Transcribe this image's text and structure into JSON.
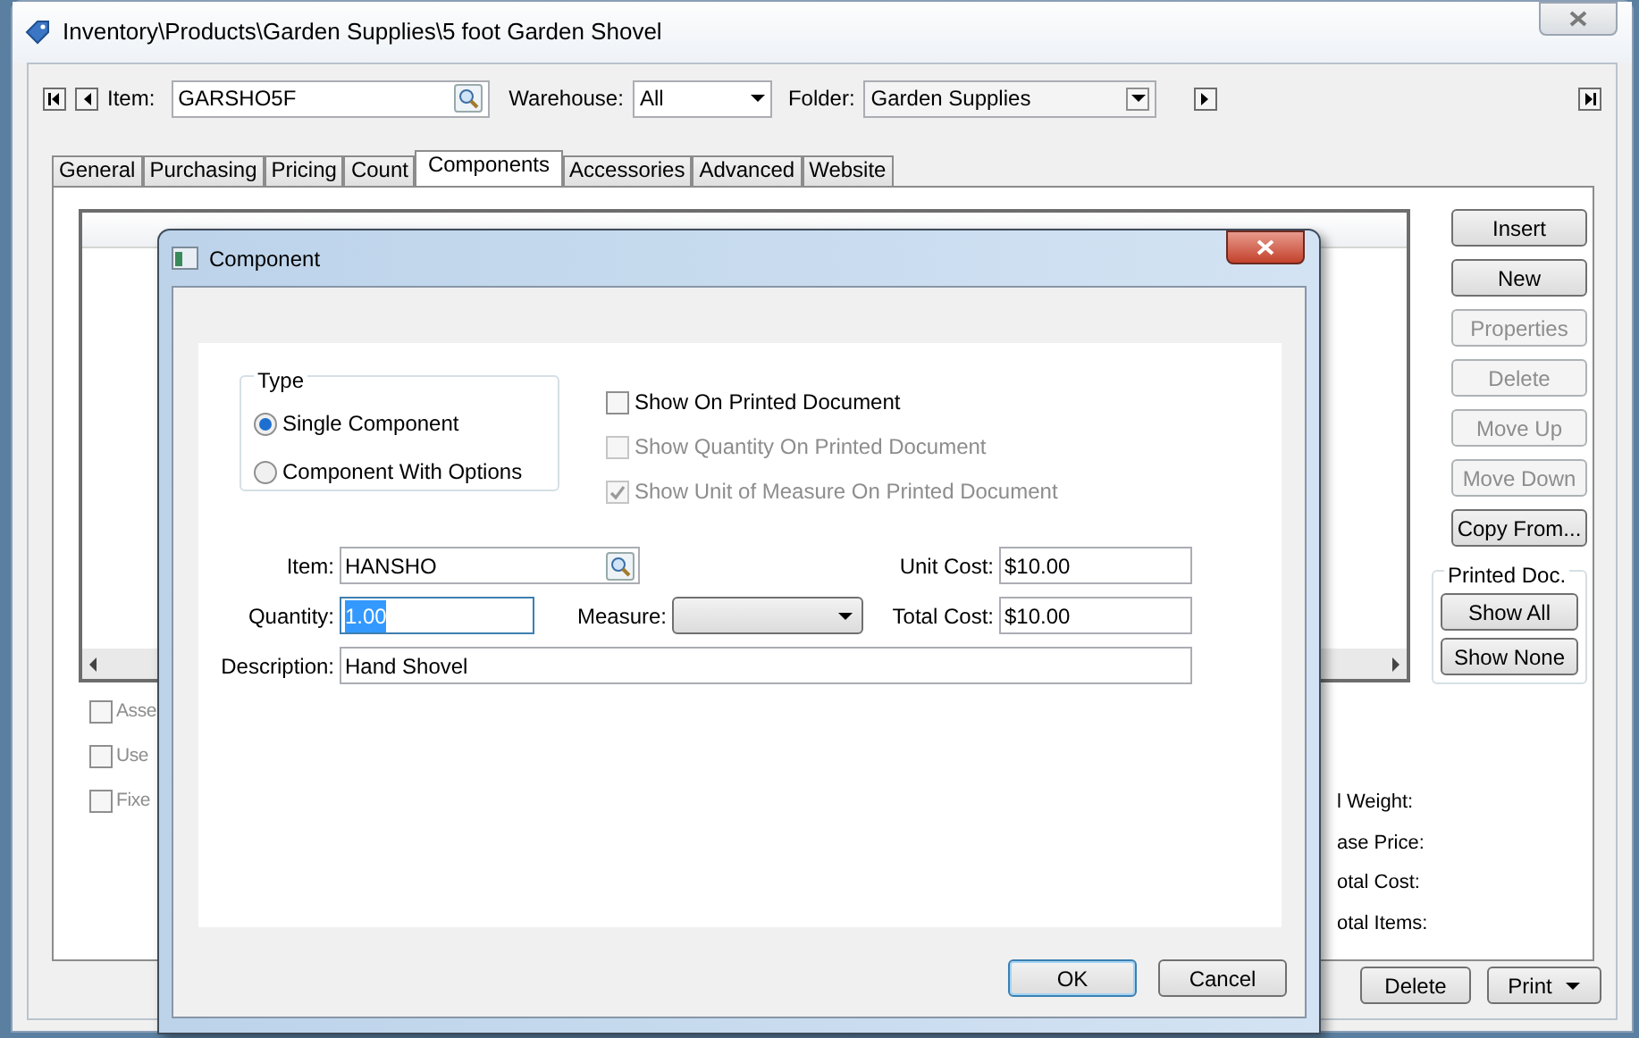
{
  "window": {
    "title": "Inventory\\Products\\Garden Supplies\\5 foot Garden Shovel"
  },
  "toolbar": {
    "item_label": "Item:",
    "item_value": "GARSHO5F",
    "warehouse_label": "Warehouse:",
    "warehouse_value": "All",
    "folder_label": "Folder:",
    "folder_value": "Garden Supplies"
  },
  "tabs": [
    {
      "label": "General",
      "selected": false
    },
    {
      "label": "Purchasing",
      "selected": false
    },
    {
      "label": "Pricing",
      "selected": false
    },
    {
      "label": "Count",
      "selected": false
    },
    {
      "label": "Components",
      "selected": true
    },
    {
      "label": "Accessories",
      "selected": false
    },
    {
      "label": "Advanced",
      "selected": false
    },
    {
      "label": "Website",
      "selected": false
    }
  ],
  "grid": {
    "horizontal_scrollbar": true
  },
  "side_buttons": [
    {
      "label": "Insert",
      "disabled": false
    },
    {
      "label": "New",
      "disabled": false
    },
    {
      "label": "Properties",
      "disabled": true
    },
    {
      "label": "Delete",
      "disabled": true
    },
    {
      "label": "Move Up",
      "disabled": true
    },
    {
      "label": "Move Down",
      "disabled": true
    },
    {
      "label": "Copy From...",
      "disabled": false
    }
  ],
  "printed_doc": {
    "title": "Printed Doc.",
    "buttons": [
      "Show All",
      "Show None"
    ]
  },
  "options": [
    {
      "label": "Asse",
      "checked": false
    },
    {
      "label": "Use",
      "checked": false
    },
    {
      "label": "Fixe",
      "checked": false
    }
  ],
  "totals": [
    "l Weight:",
    "ase Price:",
    "otal Cost:",
    "otal Items:"
  ],
  "footer_buttons": [
    {
      "label": "Delete",
      "dropdown": false
    },
    {
      "label": "Print",
      "dropdown": true
    }
  ],
  "dialog": {
    "title": "Component",
    "type_group": {
      "title": "Type",
      "options": [
        {
          "label": "Single Component",
          "selected": true
        },
        {
          "label": "Component With Options",
          "selected": false
        }
      ]
    },
    "print_options": [
      {
        "label": "Show On Printed Document",
        "checked": false,
        "disabled": false
      },
      {
        "label": "Show Quantity On Printed Document",
        "checked": false,
        "disabled": true
      },
      {
        "label": "Show Unit of Measure On Printed Document",
        "checked": true,
        "disabled": true
      }
    ],
    "item": {
      "label": "Item:",
      "value": "HANSHO"
    },
    "quantity": {
      "label": "Quantity:",
      "value": "1.00",
      "text_selected": true
    },
    "measure": {
      "label": "Measure:"
    },
    "unit_cost": {
      "label": "Unit Cost:",
      "value": "$10.00"
    },
    "total_cost": {
      "label": "Total Cost:",
      "value": "$10.00"
    },
    "description": {
      "label": "Description:",
      "value": "Hand Shovel"
    },
    "buttons": [
      {
        "label": "OK",
        "default": true
      },
      {
        "label": "Cancel",
        "default": false
      }
    ]
  }
}
